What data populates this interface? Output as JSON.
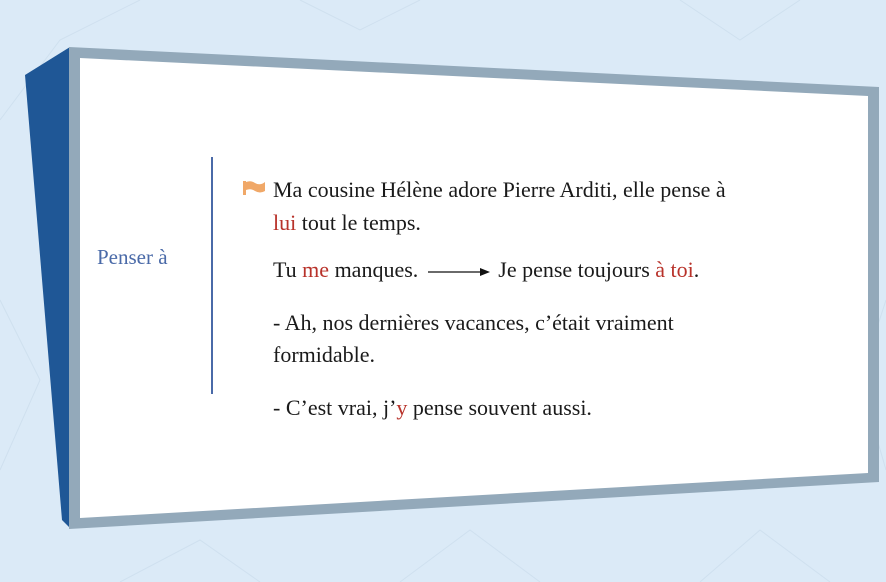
{
  "slide": {
    "label": "Penser à",
    "bullet_icon": "flag-icon",
    "colors": {
      "accent_blue": "#4a6aa8",
      "highlight_red": "#b8322a",
      "frame_side": "#1f5796",
      "frame_border": "#93a9ba",
      "flag": "#f0a868"
    },
    "lines": {
      "l1": "Ma cousine Hélène adore Pierre Arditi, elle pense à",
      "l2_red": "lui",
      "l2_rest": " tout le temps.",
      "l3_a": "Tu ",
      "l3_red": "me",
      "l3_b": " manques.",
      "l3_c": "Je pense toujours ",
      "l3_red2": "à toi",
      "l3_d": ".",
      "l4": "- Ah, nos dernières vacances, c’était vraiment",
      "l5": "formidable.",
      "l6_a": "- C’est vrai, j’",
      "l6_red": "y",
      "l6_b": " pense souvent aussi."
    }
  }
}
